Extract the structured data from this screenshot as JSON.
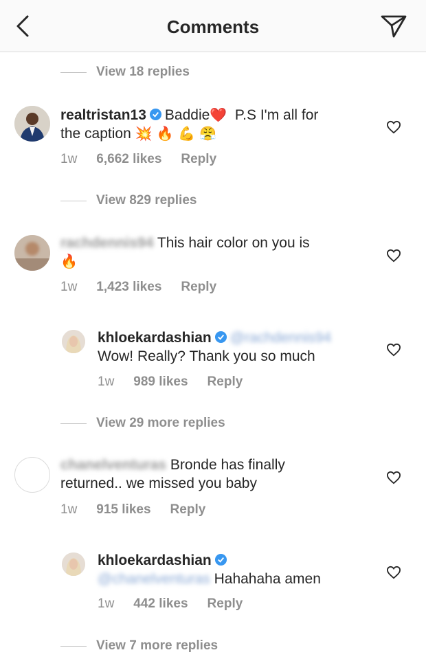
{
  "header": {
    "title": "Comments",
    "back_icon": "chevron-left-icon",
    "send_icon": "paper-plane-icon"
  },
  "view_replies_1": "View 18 replies",
  "comments": [
    {
      "username": "realtristan13",
      "verified": true,
      "text_1": "Baddie",
      "emoji_1": "❤️",
      "text_2": "P.S I'm all for",
      "text_3": "the caption",
      "emoji_2": "💥 🔥 💪 😤",
      "time": "1w",
      "likes": "6,662 likes",
      "reply": "Reply"
    },
    {
      "username": "rachdennis94",
      "text_1": "This hair color on you is",
      "emoji_1": "🔥",
      "time": "1w",
      "likes": "1,423 likes",
      "reply": "Reply"
    },
    {
      "username": "khloekardashian",
      "verified": true,
      "mention": "@rachdennis94",
      "text_1": "Wow! Really? Thank you so much",
      "time": "1w",
      "likes": "989 likes",
      "reply": "Reply"
    },
    {
      "username": "chanelventuras",
      "text_1": "Bronde has finally",
      "text_2": "returned.. we missed you baby",
      "time": "1w",
      "likes": "915 likes",
      "reply": "Reply"
    },
    {
      "username": "khloekardashian",
      "verified": true,
      "mention": "@chanelventuras",
      "text_1": "Hahahaha amen",
      "time": "1w",
      "likes": "442 likes",
      "reply": "Reply"
    }
  ],
  "view_replies_2": "View 829 replies",
  "view_replies_3": "View 29 more replies",
  "view_replies_4": "View 7 more replies",
  "colors": {
    "verified": "#3897f0",
    "meta": "#8e8e8e",
    "text": "#262626"
  }
}
